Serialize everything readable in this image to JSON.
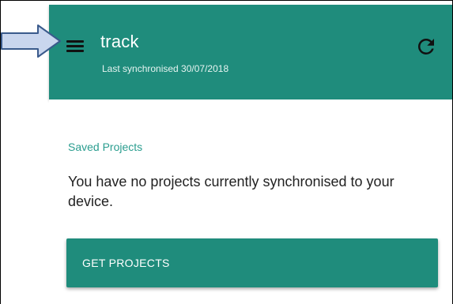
{
  "header": {
    "title": "track",
    "sync_status": "Last synchronised 30/07/2018",
    "menu_icon": "hamburger-menu-icon",
    "refresh_icon": "refresh-icon"
  },
  "main": {
    "section_title": "Saved Projects",
    "empty_message": "You have no projects currently synchronised to your device.",
    "get_projects_label": "GET PROJECTS"
  },
  "annotation": {
    "arrow_icon": "pointer-arrow-icon"
  },
  "colors": {
    "primary": "#1f8c7c",
    "section_title": "#2a9d8f",
    "arrow_fill": "#c9d6ee",
    "arrow_stroke": "#3a5a8c"
  }
}
